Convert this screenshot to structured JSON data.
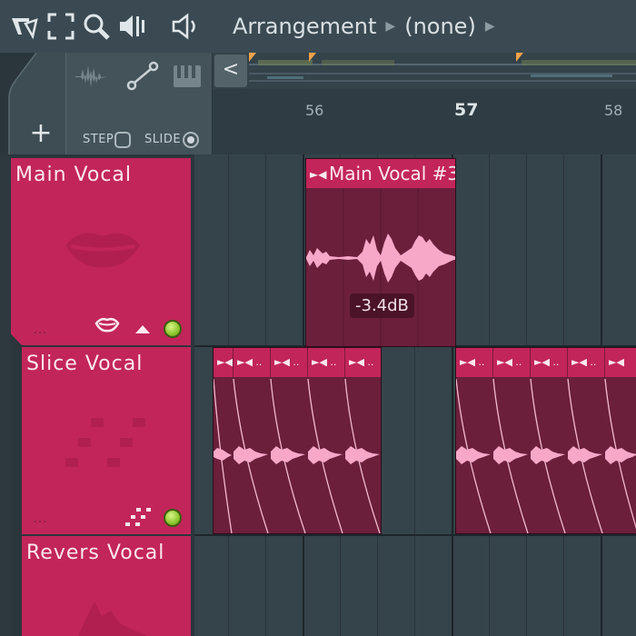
{
  "toolbar": {
    "icons": [
      "snap-icon",
      "fullscreen-icon",
      "zoom-icon",
      "audio-meter-icon",
      "speaker-icon"
    ],
    "title": "Arrangement",
    "pattern": "(none)"
  },
  "header": {
    "step_label": "STEP",
    "slide_label": "SLIDE",
    "add_label": "+",
    "scroll_left_label": "<",
    "bar_numbers": [
      "56",
      "57",
      "58"
    ]
  },
  "tracks": [
    {
      "name": "Main Vocal",
      "icon": "lips-icon"
    },
    {
      "name": "Slice Vocal",
      "icon": "slice-icon"
    },
    {
      "name": "Revers Vocal",
      "icon": "reverse-icon"
    }
  ],
  "clips": {
    "main_vocal_title": "Main Vocal #3",
    "volume_tooltip": "-3.4dB"
  },
  "colors": {
    "track_color": "#c2255a",
    "clip_body": "#6b1f3b",
    "waveform": "#f7a8c8",
    "status_led": "#8cc62b"
  }
}
